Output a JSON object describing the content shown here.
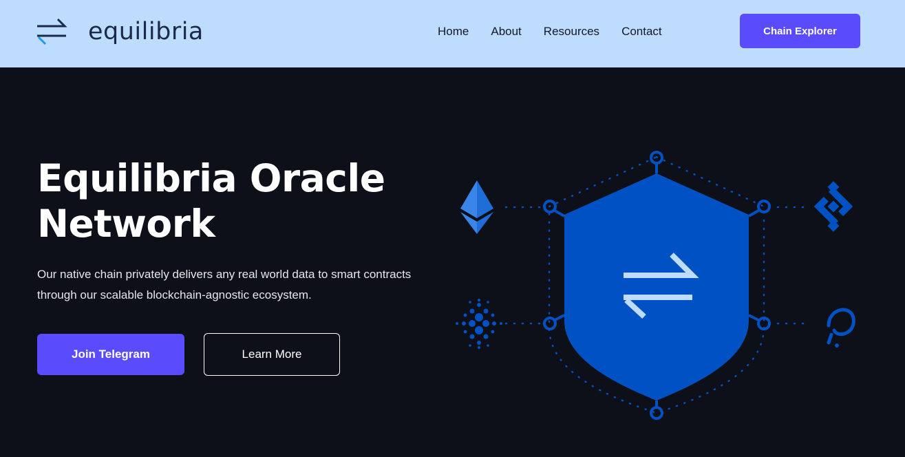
{
  "header": {
    "logo_text": "equilibria",
    "nav": [
      {
        "label": "Home"
      },
      {
        "label": "About"
      },
      {
        "label": "Resources"
      },
      {
        "label": "Contact"
      }
    ],
    "cta_label": "Chain Explorer"
  },
  "hero": {
    "title": "Equilibria Oracle Network",
    "description": "Our native chain privately delivers any real world data to smart contracts through our scalable blockchain-agnostic ecosystem.",
    "primary_button": "Join Telegram",
    "secondary_button": "Learn More"
  },
  "illustration": {
    "center_icon": "exchange-arrows-icon",
    "chains": [
      "ethereum-icon",
      "binance-icon",
      "cardano-icon",
      "polkadot-icon"
    ]
  },
  "colors": {
    "header_bg": "#bedcfe",
    "page_bg": "#0d1018",
    "accent": "#5a4cfd",
    "shield": "#0052c4"
  }
}
